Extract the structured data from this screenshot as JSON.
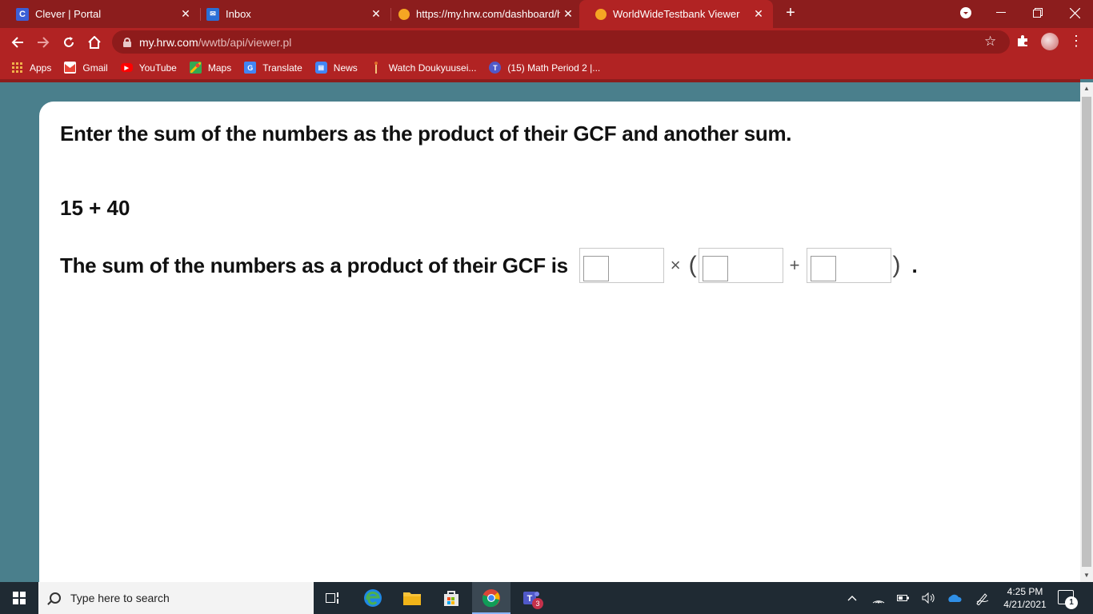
{
  "browser": {
    "tabs": [
      {
        "title": "Clever | Portal",
        "favicon": "clever-icon",
        "active": false
      },
      {
        "title": "Inbox",
        "favicon": "mail-icon",
        "active": false
      },
      {
        "title": "https://my.hrw.com/dashboard/h",
        "favicon": "loading-dot-icon",
        "active": false
      },
      {
        "title": "WorldWideTestbank Viewer",
        "favicon": "loading-dot-icon",
        "active": true
      }
    ],
    "url_host": "my.hrw.com",
    "url_path": "/wwtb/api/viewer.pl",
    "bookmarks": [
      {
        "label": "Apps",
        "icon": "apps-grid-icon"
      },
      {
        "label": "Gmail",
        "icon": "gmail-icon"
      },
      {
        "label": "YouTube",
        "icon": "youtube-icon"
      },
      {
        "label": "Maps",
        "icon": "maps-icon"
      },
      {
        "label": "Translate",
        "icon": "translate-icon"
      },
      {
        "label": "News",
        "icon": "news-icon"
      },
      {
        "label": "Watch Doukyuusei...",
        "icon": "bookmark-page-icon"
      },
      {
        "label": "(15) Math Period 2 |...",
        "icon": "teams-icon"
      }
    ],
    "theme_color": "#b12323",
    "tabstrip_color": "#8c1d1d"
  },
  "question": {
    "prompt": "Enter the sum of the numbers as the product of their GCF and another sum.",
    "expression": "15 + 40",
    "answer_lead": "The sum of the numbers as a product of their GCF is",
    "times_symbol": "×",
    "open_paren": "(",
    "plus_symbol": "+",
    "close_paren": ")",
    "period": "."
  },
  "taskbar": {
    "search_placeholder": "Type here to search",
    "time": "4:25 PM",
    "date": "4/21/2021",
    "notification_count": "1",
    "teams_badge": "3"
  }
}
